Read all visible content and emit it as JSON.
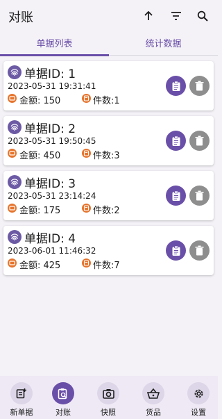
{
  "appbar": {
    "title": "对账",
    "actions": [
      {
        "icon": "arrow-up-icon"
      },
      {
        "icon": "sort-icon"
      },
      {
        "icon": "search-icon"
      }
    ]
  },
  "tabs": [
    {
      "label": "单据列表",
      "active": true
    },
    {
      "label": "统计数据",
      "active": false
    }
  ],
  "records": [
    {
      "id_label": "单据ID: 1",
      "time": "2023-05-31 19:31:41",
      "amount": "金额: 150",
      "count": "件数:1"
    },
    {
      "id_label": "单据ID: 2",
      "time": "2023-05-31 19:50:45",
      "amount": "金额: 450",
      "count": "件数:3"
    },
    {
      "id_label": "单据ID: 3",
      "time": "2023-05-31 23:14:24",
      "amount": "金额: 175",
      "count": "件数:2"
    },
    {
      "id_label": "单据ID: 4",
      "time": "2023-06-01 11:46:32",
      "amount": "金额: 425",
      "count": "件数:7"
    }
  ],
  "nav": [
    {
      "label": "新单据",
      "icon": "new-document-icon",
      "active": false
    },
    {
      "label": "对账",
      "icon": "clipboard-search-icon",
      "active": true
    },
    {
      "label": "快照",
      "icon": "camera-icon",
      "active": false
    },
    {
      "label": "货品",
      "icon": "basket-icon",
      "active": false
    },
    {
      "label": "设置",
      "icon": "gear-icon",
      "active": false
    }
  ],
  "colors": {
    "accent": "#6a4fa8",
    "delete": "#8e8e8e",
    "money_icon": "#e6742c",
    "background": "#f4f2f7"
  }
}
